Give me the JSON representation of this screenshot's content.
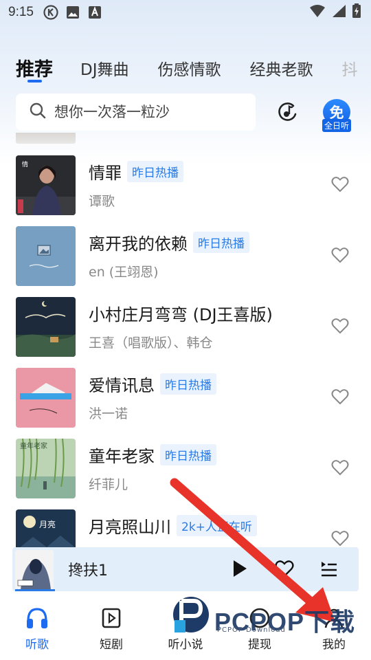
{
  "status_bar": {
    "time": "9:15",
    "icons": [
      "k-circle-icon",
      "image-icon",
      "a-box-icon"
    ],
    "right_icons": [
      "wifi-icon",
      "signal-icon",
      "battery-icon"
    ]
  },
  "tabs": [
    "推荐",
    "DJ舞曲",
    "伤感情歌",
    "经典老歌",
    "抖"
  ],
  "active_tab": 0,
  "search": {
    "placeholder": "想你一次落一粒沙",
    "free_badge_main": "免",
    "free_badge_sub": "全日听"
  },
  "songs": [
    {
      "title": "情罪",
      "tag": "昨日热播",
      "artist": "谭歌"
    },
    {
      "title": "离开我的依赖",
      "tag": "昨日热播",
      "artist": "en (王翊恩)"
    },
    {
      "title": "小村庄月弯弯 (DJ王喜版)",
      "tag": "",
      "artist": "王喜（唱歌版）、韩仓"
    },
    {
      "title": "爱情讯息",
      "tag": "昨日热播",
      "artist": "洪一诺"
    },
    {
      "title": "童年老家",
      "tag": "昨日热播",
      "artist": "纤菲儿"
    },
    {
      "title": "月亮照山川",
      "tag": "2k+人正在听",
      "artist": ""
    }
  ],
  "covers": [
    {
      "caption": "情罪"
    },
    {
      "caption": "离开我的依赖"
    },
    {
      "caption": "小村庄月弯弯"
    },
    {
      "caption": ""
    },
    {
      "caption": "童年老家"
    },
    {
      "caption": "月亮照山川"
    }
  ],
  "mini_player": {
    "title": "搀扶1"
  },
  "bottom_nav": [
    {
      "label": "听歌",
      "icon": "headphones-icon",
      "active": true
    },
    {
      "label": "短剧",
      "icon": "play-square-icon",
      "active": false
    },
    {
      "label": "听小说",
      "icon": "book-icon",
      "active": false
    },
    {
      "label": "提现",
      "icon": "coin-icon",
      "active": false
    },
    {
      "label": "我的",
      "icon": "person-icon",
      "active": false
    }
  ],
  "watermark": {
    "text": "PCPOP下载",
    "sub": "PCPOP Download"
  },
  "colors": {
    "accent": "#1d6bf0",
    "tag_bg": "#e9f2fd",
    "tag_text": "#2b7be6",
    "arrow": "#e8332a"
  }
}
